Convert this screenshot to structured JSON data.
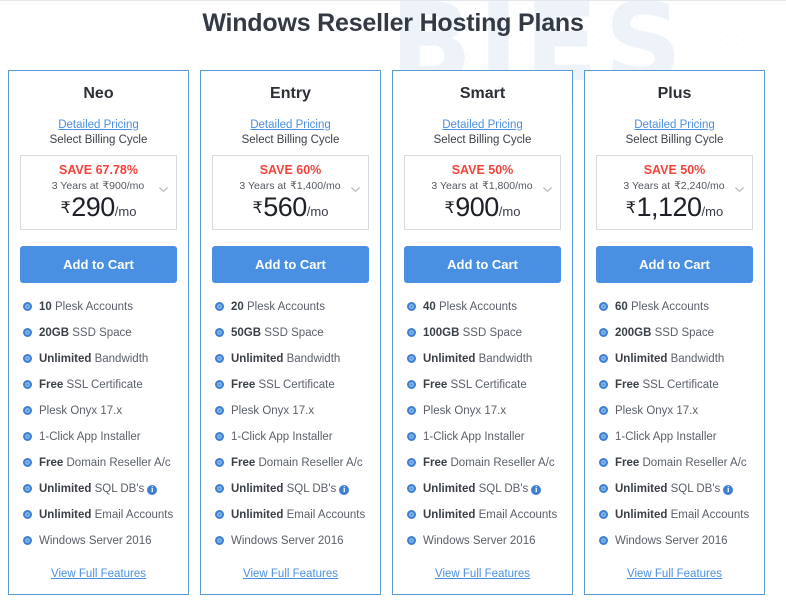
{
  "page": {
    "title": "Windows Reseller Hosting Plans",
    "watermark_text": "BIES"
  },
  "colors": {
    "accent_blue": "#4a90e2",
    "card_border": "#5b9bd5",
    "save_red": "#f4423c",
    "bullet_blue": "#3d7fd1",
    "title_text": "#333a44"
  },
  "labels": {
    "detailed_pricing": "Detailed Pricing",
    "select_billing_cycle": "Select Billing Cycle",
    "add_to_cart": "Add to Cart",
    "view_full_features": "View Full Features",
    "info_glyph": "i"
  },
  "plans": [
    {
      "name": "Neo",
      "save_badge": "SAVE 67.78%",
      "original_line": "3 Years at",
      "original_price": "₹900/mo",
      "currency": "₹",
      "price": "290",
      "per": "/mo",
      "features": [
        {
          "bold": "10",
          "rest": " Plesk Accounts",
          "info": false
        },
        {
          "bold": "20GB",
          "rest": " SSD Space",
          "info": false
        },
        {
          "bold": "Unlimited",
          "rest": " Bandwidth",
          "info": false
        },
        {
          "bold": "Free",
          "rest": " SSL Certificate",
          "info": false
        },
        {
          "bold": "",
          "rest": "Plesk Onyx 17.x",
          "info": false
        },
        {
          "bold": "",
          "rest": "1-Click App Installer",
          "info": false
        },
        {
          "bold": "Free",
          "rest": " Domain Reseller A/c",
          "info": false
        },
        {
          "bold": "Unlimited",
          "rest": " SQL DB's",
          "info": true
        },
        {
          "bold": "Unlimited",
          "rest": " Email Accounts",
          "info": false
        },
        {
          "bold": "",
          "rest": "Windows Server 2016",
          "info": false
        }
      ]
    },
    {
      "name": "Entry",
      "save_badge": "SAVE 60%",
      "original_line": "3 Years at",
      "original_price": "₹1,400/mo",
      "currency": "₹",
      "price": "560",
      "per": "/mo",
      "features": [
        {
          "bold": "20",
          "rest": " Plesk Accounts",
          "info": false
        },
        {
          "bold": "50GB",
          "rest": " SSD Space",
          "info": false
        },
        {
          "bold": "Unlimited",
          "rest": " Bandwidth",
          "info": false
        },
        {
          "bold": "Free",
          "rest": " SSL Certificate",
          "info": false
        },
        {
          "bold": "",
          "rest": "Plesk Onyx 17.x",
          "info": false
        },
        {
          "bold": "",
          "rest": "1-Click App Installer",
          "info": false
        },
        {
          "bold": "Free",
          "rest": " Domain Reseller A/c",
          "info": false
        },
        {
          "bold": "Unlimited",
          "rest": " SQL DB's",
          "info": true
        },
        {
          "bold": "Unlimited",
          "rest": " Email Accounts",
          "info": false
        },
        {
          "bold": "",
          "rest": "Windows Server 2016",
          "info": false
        }
      ]
    },
    {
      "name": "Smart",
      "save_badge": "SAVE 50%",
      "original_line": "3 Years at",
      "original_price": "₹1,800/mo",
      "currency": "₹",
      "price": "900",
      "per": "/mo",
      "features": [
        {
          "bold": "40",
          "rest": " Plesk Accounts",
          "info": false
        },
        {
          "bold": "100GB",
          "rest": " SSD Space",
          "info": false
        },
        {
          "bold": "Unlimited",
          "rest": " Bandwidth",
          "info": false
        },
        {
          "bold": "Free",
          "rest": " SSL Certificate",
          "info": false
        },
        {
          "bold": "",
          "rest": "Plesk Onyx 17.x",
          "info": false
        },
        {
          "bold": "",
          "rest": "1-Click App Installer",
          "info": false
        },
        {
          "bold": "Free",
          "rest": " Domain Reseller A/c",
          "info": false
        },
        {
          "bold": "Unlimited",
          "rest": " SQL DB's",
          "info": true
        },
        {
          "bold": "Unlimited",
          "rest": " Email Accounts",
          "info": false
        },
        {
          "bold": "",
          "rest": "Windows Server 2016",
          "info": false
        }
      ]
    },
    {
      "name": "Plus",
      "save_badge": "SAVE 50%",
      "original_line": "3 Years at",
      "original_price": "₹2,240/mo",
      "currency": "₹",
      "price": "1,120",
      "per": "/mo",
      "features": [
        {
          "bold": "60",
          "rest": " Plesk Accounts",
          "info": false
        },
        {
          "bold": "200GB",
          "rest": " SSD Space",
          "info": false
        },
        {
          "bold": "Unlimited",
          "rest": " Bandwidth",
          "info": false
        },
        {
          "bold": "Free",
          "rest": " SSL Certificate",
          "info": false
        },
        {
          "bold": "",
          "rest": "Plesk Onyx 17.x",
          "info": false
        },
        {
          "bold": "",
          "rest": "1-Click App Installer",
          "info": false
        },
        {
          "bold": "Free",
          "rest": " Domain Reseller A/c",
          "info": false
        },
        {
          "bold": "Unlimited",
          "rest": " SQL DB's",
          "info": true
        },
        {
          "bold": "Unlimited",
          "rest": " Email Accounts",
          "info": false
        },
        {
          "bold": "",
          "rest": "Windows Server 2016",
          "info": false
        }
      ]
    }
  ]
}
